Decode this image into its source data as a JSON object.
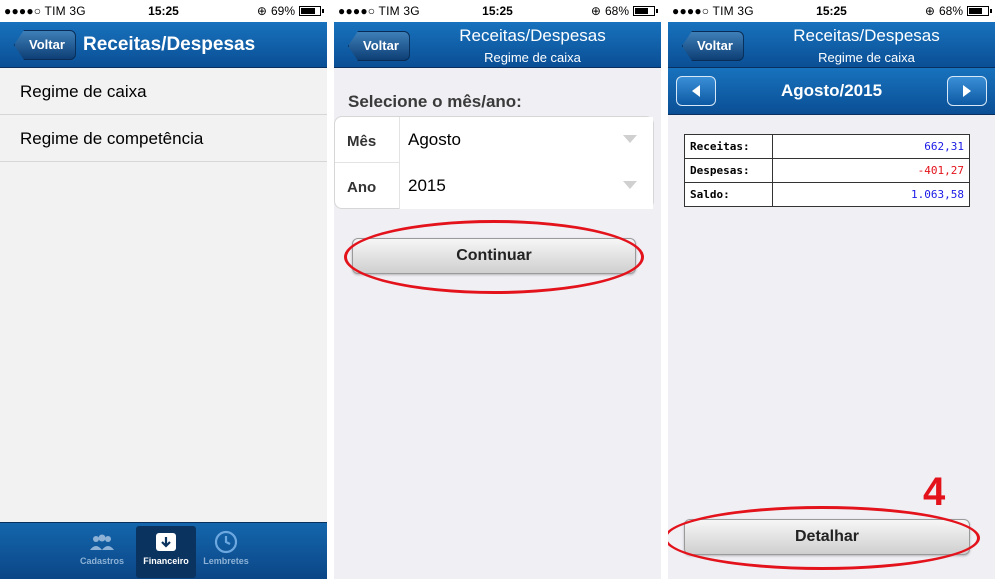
{
  "colors": {
    "nav_blue": "#0a4f95",
    "annotation_red": "#e3121b",
    "negative_red": "#e3121b",
    "value_blue": "#1a1ae6"
  },
  "screen1": {
    "status": {
      "carrier": "●●●●○ TIM  3G",
      "time": "15:25",
      "battery": "69%",
      "battery_level": 0.69
    },
    "nav": {
      "back_label": "Voltar",
      "title": "Receitas/Despesas"
    },
    "menu": [
      {
        "label": "Regime de caixa"
      },
      {
        "label": "Regime de competência"
      }
    ],
    "tabs": [
      {
        "label": "Cadastros",
        "icon": "people-icon"
      },
      {
        "label": "Financeiro",
        "icon": "inbox-download-icon"
      },
      {
        "label": "Lembretes",
        "icon": "clock-icon"
      }
    ]
  },
  "screen2": {
    "status": {
      "carrier": "●●●●○ TIM  3G",
      "time": "15:25",
      "battery": "68%",
      "battery_level": 0.68
    },
    "nav": {
      "back_label": "Voltar",
      "title": "Receitas/Despesas",
      "subtitle": "Regime de caixa"
    },
    "prompt": "Selecione o mês/ano:",
    "fields": [
      {
        "label": "Mês",
        "value": "Agosto"
      },
      {
        "label": "Ano",
        "value": "2015"
      }
    ],
    "continue_label": "Continuar"
  },
  "screen3": {
    "status": {
      "carrier": "●●●●○ TIM  3G",
      "time": "15:25",
      "battery": "68%",
      "battery_level": 0.68
    },
    "nav": {
      "back_label": "Voltar",
      "title": "Receitas/Despesas",
      "subtitle": "Regime de caixa"
    },
    "month_label": "Agosto/2015",
    "report": [
      {
        "label": "Receitas:",
        "value": "662,31",
        "color": "#1a1ae6"
      },
      {
        "label": "Despesas:",
        "value": "-401,27",
        "color": "#e3121b"
      },
      {
        "label": "Saldo:",
        "value": "1.063,58",
        "color": "#1a1ae6"
      }
    ],
    "annotation_number": "4",
    "detail_label": "Detalhar"
  }
}
